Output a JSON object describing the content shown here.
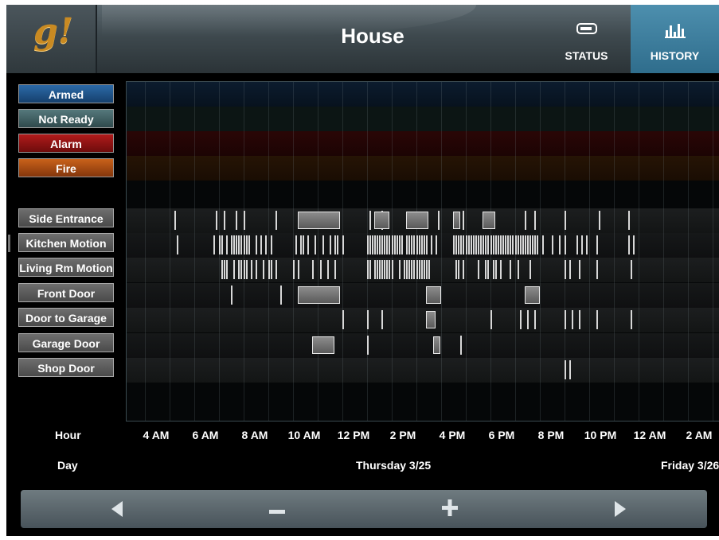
{
  "header": {
    "logo_text": "g!",
    "title": "House",
    "status_label": "STATUS",
    "history_label": "HISTORY",
    "accent_color": "#3a7fa0",
    "logo_color": "#c98a22"
  },
  "legend": [
    {
      "label": "Armed",
      "color": "#1f4f8a"
    },
    {
      "label": "Not Ready",
      "color": "#3d5b5e"
    },
    {
      "label": "Alarm",
      "color": "#8a1313"
    },
    {
      "label": "Fire",
      "color": "#a44a12"
    }
  ],
  "sensors": [
    {
      "label": "Side Entrance"
    },
    {
      "label": "Kitchen Motion"
    },
    {
      "label": "Living Rm Motion"
    },
    {
      "label": "Front Door"
    },
    {
      "label": "Door to Garage"
    },
    {
      "label": "Garage Door"
    },
    {
      "label": "Shop Door"
    }
  ],
  "axis": {
    "hour_label": "Hour",
    "day_label": "Day",
    "hours": [
      "4 AM",
      "6 AM",
      "8 AM",
      "10 AM",
      "12 PM",
      "2 PM",
      "4 PM",
      "6 PM",
      "8 PM",
      "10 PM",
      "12 AM",
      "2 AM"
    ],
    "day_thursday": "Thursday 3/25",
    "day_friday": "Friday 3/26"
  },
  "footer": {
    "back_icon": "left-arrow-icon",
    "zoom_out_icon": "minus-icon",
    "zoom_in_icon": "plus-icon",
    "forward_icon": "right-arrow-icon"
  },
  "events": {
    "side-entrance": {
      "ticks": [
        4.7,
        6.4,
        6.7,
        7.2,
        7.5,
        8.8,
        12.6,
        13.1,
        15.4,
        16.4,
        18.9,
        19.3,
        20.5,
        21.9,
        23.1
      ],
      "blocks": [
        [
          9.7,
          11.4
        ],
        [
          12.8,
          13.4
        ],
        [
          14.1,
          15.0
        ],
        [
          16.0,
          16.3
        ],
        [
          17.2,
          17.7
        ]
      ]
    },
    "kitchen-motion": {
      "ticks": [
        4.8,
        6.3,
        6.5,
        6.6,
        6.8,
        7.0,
        7.1,
        7.2,
        7.3,
        7.4,
        7.5,
        7.6,
        7.7,
        8.0,
        8.2,
        8.4,
        8.6,
        9.6,
        9.8,
        9.9,
        10.1,
        10.4,
        10.7,
        11.0,
        11.2,
        11.3,
        11.5,
        12.5,
        12.6,
        12.7,
        12.8,
        12.9,
        13.0,
        13.1,
        13.2,
        13.3,
        13.4,
        13.5,
        13.6,
        13.7,
        13.8,
        13.9,
        14.1,
        14.2,
        14.3,
        14.4,
        14.5,
        14.6,
        14.7,
        14.8,
        14.9,
        15.1,
        15.3,
        16.0,
        16.1,
        16.2,
        16.3,
        16.4,
        16.5,
        16.6,
        16.7,
        16.8,
        16.9,
        17.0,
        17.1,
        17.2,
        17.3,
        17.4,
        17.5,
        17.6,
        17.7,
        17.8,
        17.9,
        18.0,
        18.1,
        18.2,
        18.3,
        18.4,
        18.5,
        18.6,
        18.7,
        18.8,
        18.9,
        19.0,
        19.1,
        19.2,
        19.3,
        19.4,
        19.6,
        20.0,
        20.3,
        20.5,
        21.0,
        21.2,
        21.4,
        21.8,
        23.1,
        23.3
      ]
    },
    "living-rm-motion": {
      "ticks": [
        6.6,
        6.7,
        6.8,
        7.1,
        7.3,
        7.4,
        7.5,
        7.6,
        7.8,
        8.0,
        8.3,
        8.5,
        8.6,
        8.8,
        9.5,
        9.7,
        10.3,
        10.6,
        10.9,
        11.2,
        12.5,
        12.6,
        12.8,
        12.9,
        13.0,
        13.1,
        13.2,
        13.3,
        13.4,
        13.5,
        13.8,
        14.0,
        14.1,
        14.2,
        14.3,
        14.4,
        14.5,
        14.6,
        14.7,
        14.8,
        14.9,
        15.0,
        16.1,
        16.2,
        16.4,
        17.0,
        17.3,
        17.4,
        17.6,
        17.7,
        17.9,
        18.3,
        18.6,
        19.1,
        20.5,
        20.7,
        21.1,
        21.8,
        23.2
      ]
    },
    "front-door": {
      "ticks": [
        7.0,
        9.0
      ],
      "blocks": [
        [
          9.7,
          11.4
        ],
        [
          14.9,
          15.5
        ],
        [
          18.9,
          19.5
        ]
      ]
    },
    "door-to-garage": {
      "ticks": [
        11.5,
        12.5,
        13.1,
        17.5,
        18.7,
        19.0,
        19.3,
        20.5,
        20.8,
        21.1,
        21.8,
        23.2
      ],
      "blocks": [
        [
          14.9,
          15.3
        ]
      ]
    },
    "garage-door": {
      "ticks": [
        12.5,
        16.3
      ],
      "blocks": [
        [
          10.3,
          11.2
        ],
        [
          15.2,
          15.5
        ]
      ]
    },
    "shop-door": {
      "ticks": [
        20.5,
        20.7
      ]
    }
  }
}
